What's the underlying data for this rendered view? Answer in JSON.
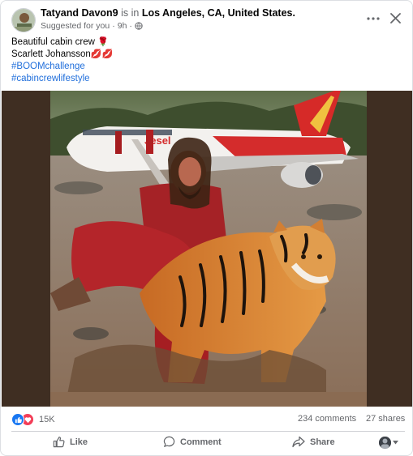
{
  "post": {
    "author_name": "Tatyand Davon9",
    "author_connector": " is in ",
    "location": "Los Angeles, CA, United States.",
    "meta_suggested": "Suggested for you",
    "meta_separator": "·",
    "meta_time": "9h",
    "meta_dot": "·",
    "text_line1": "Beautiful cabin crew",
    "text_line1_emoji": "🌹",
    "text_line2": "Scarlett Johansson",
    "text_line2_emoji": "💋💋",
    "hashtag1": "#BOOMchallenge",
    "hashtag2": "#cabincrewlifestyle"
  },
  "media": {
    "airline_livery": "Jesel"
  },
  "stats": {
    "reaction_count": "15K",
    "comments": "234 comments",
    "shares": "27 shares"
  },
  "actions": {
    "like": "Like",
    "comment": "Comment",
    "share": "Share"
  },
  "colors": {
    "link_blue": "#216fdb",
    "like_blue": "#1877f2",
    "love_red": "#f33e58",
    "muted": "#65676b"
  }
}
